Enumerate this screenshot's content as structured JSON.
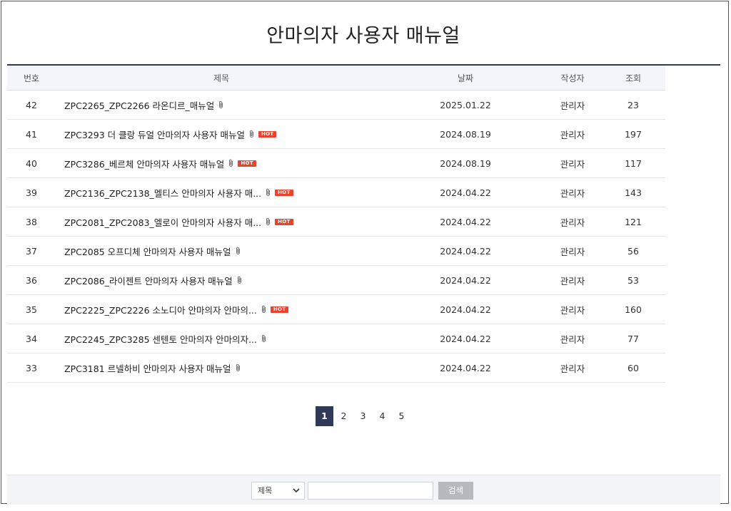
{
  "page": {
    "title": "안마의자 사용자 매뉴얼"
  },
  "table": {
    "headers": {
      "no": "번호",
      "title": "제목",
      "date": "날짜",
      "author": "작성자",
      "views": "조회"
    },
    "rows": [
      {
        "no": "42",
        "title": "ZPC2265_ZPC2266 라온디르_매뉴얼",
        "attachment": true,
        "hot": false,
        "date": "2025.01.22",
        "author": "관리자",
        "views": "23"
      },
      {
        "no": "41",
        "title": "ZPC3293 더 클랑 듀얼 안마의자 사용자 매뉴얼",
        "attachment": true,
        "hot": true,
        "date": "2024.08.19",
        "author": "관리자",
        "views": "197"
      },
      {
        "no": "40",
        "title": "ZPC3286_베르체 안마의자 사용자 매뉴얼",
        "attachment": true,
        "hot": true,
        "date": "2024.08.19",
        "author": "관리자",
        "views": "117"
      },
      {
        "no": "39",
        "title": "ZPC2136_ZPC2138_멜티스 안마의자 사용자 매...",
        "attachment": true,
        "hot": true,
        "date": "2024.04.22",
        "author": "관리자",
        "views": "143"
      },
      {
        "no": "38",
        "title": "ZPC2081_ZPC2083_엘로이 안마의자 사용자 매...",
        "attachment": true,
        "hot": true,
        "date": "2024.04.22",
        "author": "관리자",
        "views": "121"
      },
      {
        "no": "37",
        "title": "ZPC2085 오프디체 안마의자 사용자 매뉴얼",
        "attachment": true,
        "hot": false,
        "date": "2024.04.22",
        "author": "관리자",
        "views": "56"
      },
      {
        "no": "36",
        "title": "ZPC2086_라이젠트 안마의자 사용자 매뉴얼",
        "attachment": true,
        "hot": false,
        "date": "2024.04.22",
        "author": "관리자",
        "views": "53"
      },
      {
        "no": "35",
        "title": "ZPC2225_ZPC2226 소노디아 안마의자 안마의...",
        "attachment": true,
        "hot": true,
        "date": "2024.04.22",
        "author": "관리자",
        "views": "160"
      },
      {
        "no": "34",
        "title": "ZPC2245_ZPC3285 센텐토 안마의자 안마의자...",
        "attachment": true,
        "hot": false,
        "date": "2024.04.22",
        "author": "관리자",
        "views": "77"
      },
      {
        "no": "33",
        "title": "ZPC3181 르넬하비 안마의자 사용자 매뉴얼",
        "attachment": true,
        "hot": false,
        "date": "2024.04.22",
        "author": "관리자",
        "views": "60"
      }
    ],
    "hot_badge": "HOT"
  },
  "pagination": {
    "pages": [
      "1",
      "2",
      "3",
      "4",
      "5"
    ],
    "current": "1"
  },
  "search": {
    "select_value": "제목",
    "input_value": "",
    "button_label": "검색"
  },
  "colors": {
    "accent_navy": "#2f3a56",
    "hot_red": "#e8432f"
  }
}
